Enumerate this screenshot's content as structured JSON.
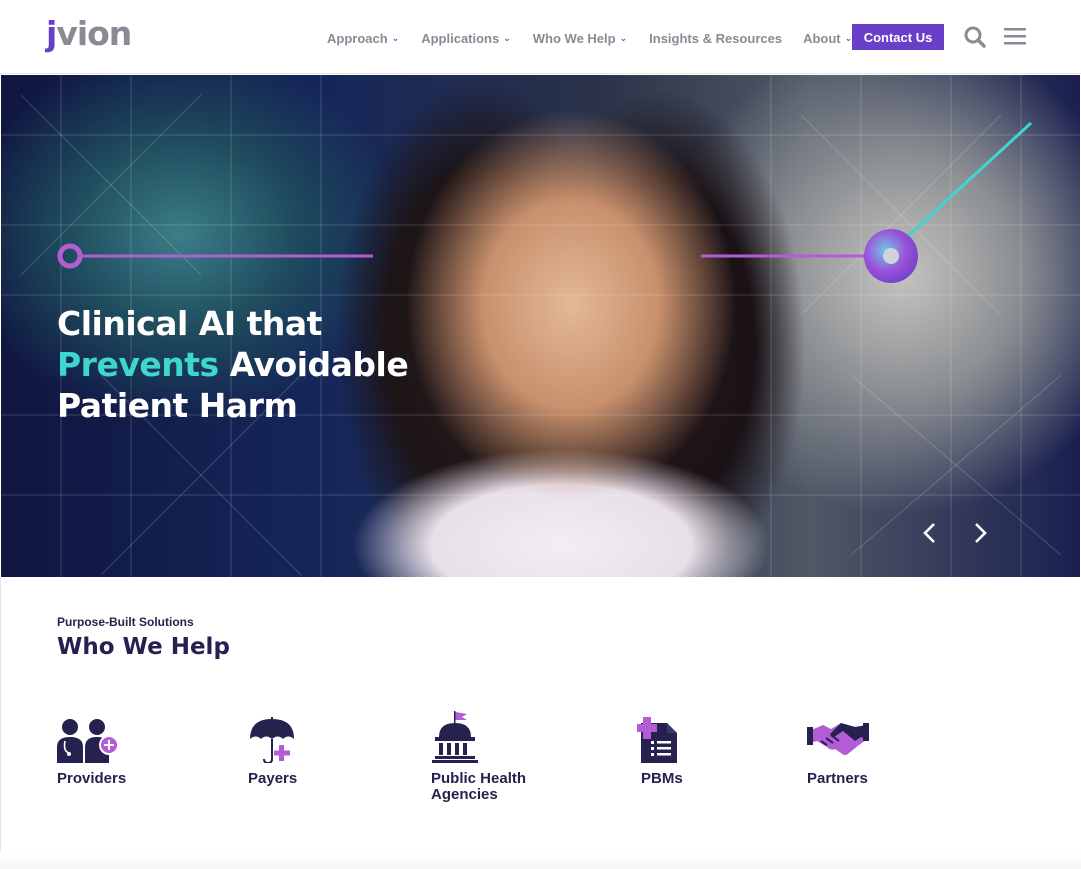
{
  "header": {
    "logo_j": "j",
    "logo_rest": "vion",
    "nav": [
      {
        "label": "Approach",
        "has_dropdown": true
      },
      {
        "label": "Applications",
        "has_dropdown": true
      },
      {
        "label": "Who We Help",
        "has_dropdown": true
      },
      {
        "label": "Insights & Resources",
        "has_dropdown": false
      },
      {
        "label": "About",
        "has_dropdown": true
      }
    ],
    "contact_label": "Contact Us",
    "search_icon": "search-icon",
    "menu_icon": "hamburger-menu-icon"
  },
  "hero": {
    "line1": "Clinical AI that",
    "accent": "Prevents",
    "line2_rest": " Avoidable",
    "line3": "Patient Harm",
    "prev_icon": "chevron-left-icon",
    "next_icon": "chevron-right-icon"
  },
  "who_we_help": {
    "eyebrow": "Purpose-Built Solutions",
    "title": "Who We Help",
    "items": [
      {
        "label": "Providers",
        "icon": "providers-icon"
      },
      {
        "label": "Payers",
        "icon": "umbrella-icon"
      },
      {
        "label": "Public Health Agencies",
        "icon": "government-building-icon"
      },
      {
        "label": "PBMs",
        "icon": "prescription-document-icon"
      },
      {
        "label": "Partners",
        "icon": "handshake-icon"
      }
    ]
  },
  "colors": {
    "brand_purple": "#6a3fc8",
    "navy": "#25224f",
    "accent_teal": "#3fd6cf",
    "gray_text": "#8a8a94"
  }
}
